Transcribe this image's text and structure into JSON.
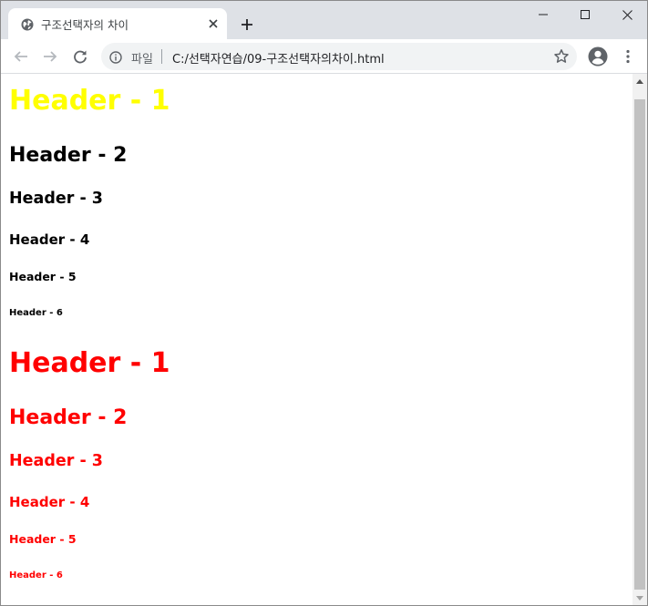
{
  "browser": {
    "tab": {
      "title": "구조선택자의 차이",
      "favicon": "globe-icon"
    },
    "window_controls": [
      "minimize-icon",
      "maximize-icon",
      "close-icon"
    ],
    "toolbar": {
      "security_chip_label": "파일",
      "url": "C:/선택자연습/09-구조선택자의차이.html"
    },
    "colors": {
      "tabstrip_bg": "#dee1e6",
      "omnibox_bg": "#f1f3f4",
      "icon_gray": "#5f6368"
    }
  },
  "page": {
    "headers_default": [
      {
        "level": 1,
        "text": "Header - 1",
        "color": "#ffff00"
      },
      {
        "level": 2,
        "text": "Header - 2",
        "color": "#000000"
      },
      {
        "level": 3,
        "text": "Header - 3",
        "color": "#000000"
      },
      {
        "level": 4,
        "text": "Header - 4",
        "color": "#000000"
      },
      {
        "level": 5,
        "text": "Header - 5",
        "color": "#000000"
      },
      {
        "level": 6,
        "text": "Header - 6",
        "color": "#000000"
      }
    ],
    "headers_red": [
      {
        "level": 1,
        "text": "Header - 1",
        "color": "#ff0000"
      },
      {
        "level": 2,
        "text": "Header - 2",
        "color": "#ff0000"
      },
      {
        "level": 3,
        "text": "Header - 3",
        "color": "#ff0000"
      },
      {
        "level": 4,
        "text": "Header - 4",
        "color": "#ff0000"
      },
      {
        "level": 5,
        "text": "Header - 5",
        "color": "#ff0000"
      },
      {
        "level": 6,
        "text": "Header - 6",
        "color": "#ff0000"
      }
    ]
  }
}
